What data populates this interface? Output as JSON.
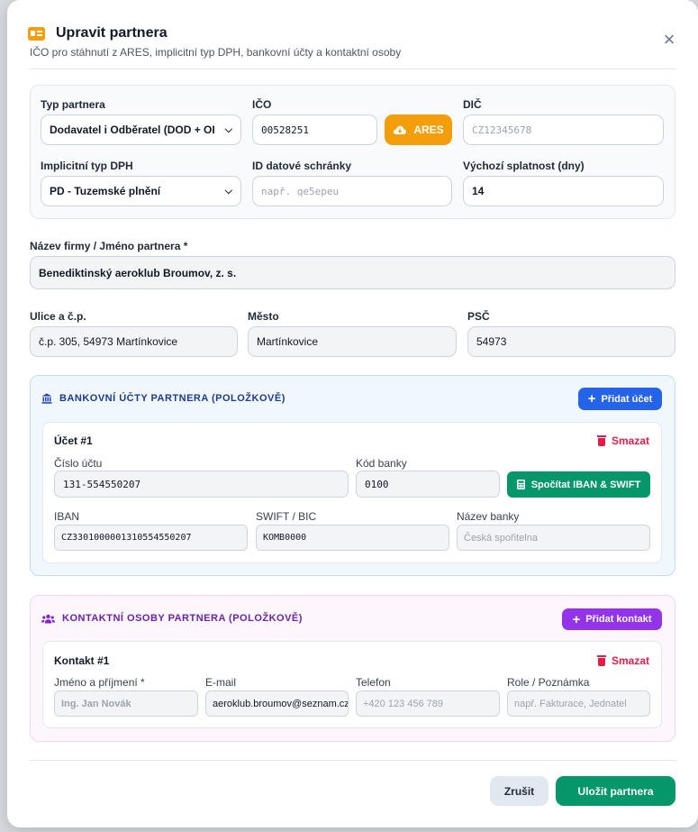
{
  "header": {
    "title": "Upravit partnera",
    "subtitle": "IČO pro stáhnutí z ARES, implicitní typ DPH, bankovní účty a kontaktní osoby",
    "close": "×"
  },
  "basics": {
    "partner_type_label": "Typ partnera",
    "partner_type_value": "Dodavatel i Odběratel (DOD + OI",
    "ico_label": "IČO",
    "ico_value": "00528251",
    "ares_button": "ARES",
    "dic_label": "DIČ",
    "dic_placeholder": "CZ12345678",
    "vat_type_label": "Implicitní typ DPH",
    "vat_type_value": "PD - Tuzemské plnění",
    "databox_label": "ID datové schránky",
    "databox_placeholder": "např. qe5epeu",
    "due_label": "Výchozí splatnost (dny)",
    "due_value": "14"
  },
  "company": {
    "name_label": "Název firmy / Jméno partnera *",
    "name_value": "Benediktinský aeroklub Broumov, z. s.",
    "street_label": "Ulice a č.p.",
    "street_value": "č.p. 305, 54973 Martínkovice",
    "city_label": "Město",
    "city_value": "Martínkovice",
    "zip_label": "PSČ",
    "zip_value": "54973"
  },
  "bank": {
    "section_title": "BANKOVNÍ ÚČTY PARTNERA (POLOŽKOVĚ)",
    "add_button": "Přidat účet",
    "accent": "#2563eb",
    "account": {
      "title": "Účet #1",
      "delete": "Smazat",
      "number_label": "Číslo účtu",
      "number_value": "131-554550207",
      "code_label": "Kód banky",
      "code_value": "0100",
      "iban_button": "Spočítat IBAN & SWIFT",
      "iban_label": "IBAN",
      "iban_value": "CZ3301000001310554550207",
      "swift_label": "SWIFT / BIC",
      "swift_value": "KOMB0000",
      "bank_name_label": "Název banky",
      "bank_name_placeholder": "Česká spořitelna"
    }
  },
  "contacts": {
    "section_title": "KONTAKTNÍ OSOBY PARTNERA (POLOŽKOVĚ)",
    "add_button": "Přidat kontakt",
    "accent": "#9333ea",
    "contact": {
      "title": "Kontakt #1",
      "delete": "Smazat",
      "name_label": "Jméno a příjmení *",
      "name_placeholder": "Ing. Jan Novák",
      "email_label": "E-mail",
      "email_value": "aeroklub.broumov@seznam.cz",
      "phone_label": "Telefon",
      "phone_placeholder": "+420 123 456 789",
      "role_label": "Role / Poznámka",
      "role_placeholder": "např. Fakturace, Jednatel"
    }
  },
  "footer": {
    "cancel": "Zrušit",
    "save": "Uložit partnera",
    "save_color": "#059669"
  },
  "icons": [
    "id-card-icon",
    "close-icon",
    "chevron-down-icon",
    "cloud-download-icon",
    "bank-icon",
    "plus-icon",
    "trash-icon",
    "calculator-icon",
    "users-icon"
  ]
}
